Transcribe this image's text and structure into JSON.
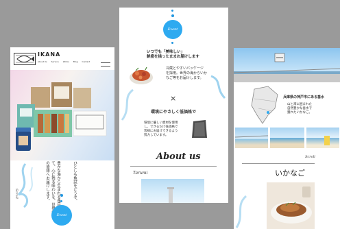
{
  "site": {
    "logo_text": "IKANA",
    "nav": [
      "About Us",
      "Service",
      "Works",
      "Blog",
      "Contact"
    ]
  },
  "mobile_left": {
    "intro_text": "豊かな海から生まれる逸品として、心に残る味わいを。世界中の皆様へお届けします。",
    "closing_text": "ひとしも魚試をどうぞ。",
    "scroll_label": "Scroll",
    "badge_label": "Event"
  },
  "mobile_center": {
    "badge_label": "Event",
    "headline_1": "いつでも「美味しい」\n鮮度を描ったままお届けします",
    "body_1": "冷蔵とやすいパッケージ\nを採用。世界の海からいか\nなご等をお届けします。",
    "times_symbol": "×",
    "headline_2": "環境にやさしく低価格で",
    "body_2": "環境に優しい資材を使用\nし、できるだけ低価格で\n皆様にお届けできるよう\n努力しています。",
    "about_title": "About us",
    "about_sub": "Tarumi"
  },
  "mobile_right": {
    "place_title": "兵庫県の神戸市にある垂水",
    "place_body": "山と海に囲まれた\n自然豊かな垂水で\n獲れたいかなご。",
    "scroll_label": "Scroll",
    "product_title": "いかなご"
  },
  "colors": {
    "accent": "#2eaaf0",
    "background": "#9a9a9a",
    "panel": "#ffffff"
  }
}
